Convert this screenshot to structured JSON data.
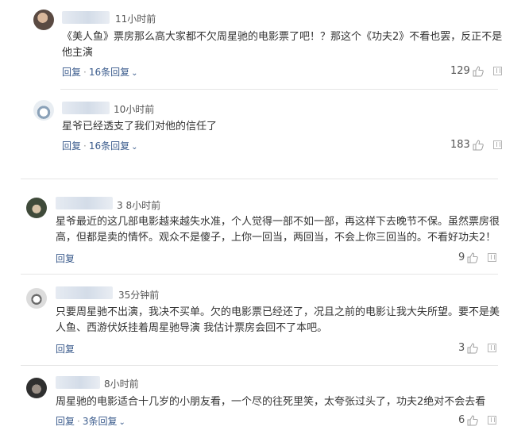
{
  "comments": [
    {
      "time": "11小时前",
      "text": "《美人鱼》票房那么高大家都不欠周星驰的电影票了吧！？那这个《功夫2》不看也罢，反正不是他主演",
      "reply_label": "回复",
      "more_replies": "16条回复",
      "likes": "129"
    },
    {
      "time": "10小时前",
      "text": "星爷已经透支了我们对他的信任了",
      "reply_label": "回复",
      "more_replies": "16条回复",
      "likes": "183"
    },
    {
      "time": "3 8小时前",
      "text": "星爷最近的这几部电影越来越失水准，个人觉得一部不如一部，再这样下去晚节不保。虽然票房很高，但都是卖的情怀。观众不是傻子，上你一回当，两回当，不会上你三回当的。不看好功夫2！",
      "reply_label": "回复",
      "likes": "9"
    },
    {
      "time": "35分钟前",
      "text": "只要周星驰不出演，我决不买单。欠的电影票已经还了，况且之前的电影让我大失所望。要不是美人鱼、西游伏妖挂着周星驰导演 我估计票房会回不了本吧。",
      "reply_label": "回复",
      "likes": "3"
    },
    {
      "time": "8小时前",
      "text": "周星驰的电影适合十几岁的小朋友看，一个尽的往死里笑，太夸张过头了，功夫2绝对不会去看",
      "reply_label": "回复",
      "more_replies": "3条回复",
      "likes": "6"
    }
  ],
  "icons": {
    "like": "thumbs-up-icon",
    "report": "report-icon",
    "expand": "chevron-down-icon"
  },
  "colors": {
    "link": "#3a5b8c",
    "text": "#333333",
    "meta": "#555555"
  }
}
